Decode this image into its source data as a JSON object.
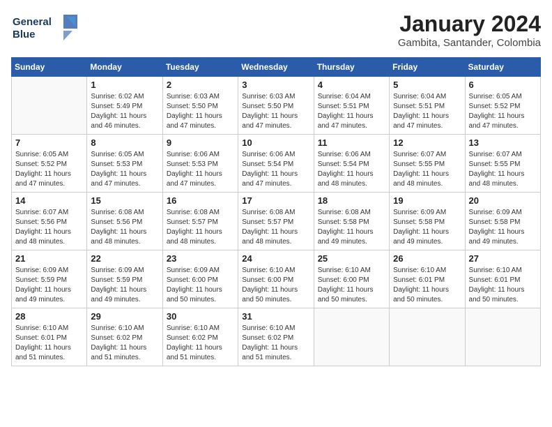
{
  "logo": {
    "line1": "General",
    "line2": "Blue"
  },
  "title": "January 2024",
  "subtitle": "Gambita, Santander, Colombia",
  "days_of_week": [
    "Sunday",
    "Monday",
    "Tuesday",
    "Wednesday",
    "Thursday",
    "Friday",
    "Saturday"
  ],
  "weeks": [
    [
      {
        "day": "",
        "info": ""
      },
      {
        "day": "1",
        "info": "Sunrise: 6:02 AM\nSunset: 5:49 PM\nDaylight: 11 hours\nand 46 minutes."
      },
      {
        "day": "2",
        "info": "Sunrise: 6:03 AM\nSunset: 5:50 PM\nDaylight: 11 hours\nand 47 minutes."
      },
      {
        "day": "3",
        "info": "Sunrise: 6:03 AM\nSunset: 5:50 PM\nDaylight: 11 hours\nand 47 minutes."
      },
      {
        "day": "4",
        "info": "Sunrise: 6:04 AM\nSunset: 5:51 PM\nDaylight: 11 hours\nand 47 minutes."
      },
      {
        "day": "5",
        "info": "Sunrise: 6:04 AM\nSunset: 5:51 PM\nDaylight: 11 hours\nand 47 minutes."
      },
      {
        "day": "6",
        "info": "Sunrise: 6:05 AM\nSunset: 5:52 PM\nDaylight: 11 hours\nand 47 minutes."
      }
    ],
    [
      {
        "day": "7",
        "info": "Sunrise: 6:05 AM\nSunset: 5:52 PM\nDaylight: 11 hours\nand 47 minutes."
      },
      {
        "day": "8",
        "info": "Sunrise: 6:05 AM\nSunset: 5:53 PM\nDaylight: 11 hours\nand 47 minutes."
      },
      {
        "day": "9",
        "info": "Sunrise: 6:06 AM\nSunset: 5:53 PM\nDaylight: 11 hours\nand 47 minutes."
      },
      {
        "day": "10",
        "info": "Sunrise: 6:06 AM\nSunset: 5:54 PM\nDaylight: 11 hours\nand 47 minutes."
      },
      {
        "day": "11",
        "info": "Sunrise: 6:06 AM\nSunset: 5:54 PM\nDaylight: 11 hours\nand 48 minutes."
      },
      {
        "day": "12",
        "info": "Sunrise: 6:07 AM\nSunset: 5:55 PM\nDaylight: 11 hours\nand 48 minutes."
      },
      {
        "day": "13",
        "info": "Sunrise: 6:07 AM\nSunset: 5:55 PM\nDaylight: 11 hours\nand 48 minutes."
      }
    ],
    [
      {
        "day": "14",
        "info": "Sunrise: 6:07 AM\nSunset: 5:56 PM\nDaylight: 11 hours\nand 48 minutes."
      },
      {
        "day": "15",
        "info": "Sunrise: 6:08 AM\nSunset: 5:56 PM\nDaylight: 11 hours\nand 48 minutes."
      },
      {
        "day": "16",
        "info": "Sunrise: 6:08 AM\nSunset: 5:57 PM\nDaylight: 11 hours\nand 48 minutes."
      },
      {
        "day": "17",
        "info": "Sunrise: 6:08 AM\nSunset: 5:57 PM\nDaylight: 11 hours\nand 48 minutes."
      },
      {
        "day": "18",
        "info": "Sunrise: 6:08 AM\nSunset: 5:58 PM\nDaylight: 11 hours\nand 49 minutes."
      },
      {
        "day": "19",
        "info": "Sunrise: 6:09 AM\nSunset: 5:58 PM\nDaylight: 11 hours\nand 49 minutes."
      },
      {
        "day": "20",
        "info": "Sunrise: 6:09 AM\nSunset: 5:58 PM\nDaylight: 11 hours\nand 49 minutes."
      }
    ],
    [
      {
        "day": "21",
        "info": "Sunrise: 6:09 AM\nSunset: 5:59 PM\nDaylight: 11 hours\nand 49 minutes."
      },
      {
        "day": "22",
        "info": "Sunrise: 6:09 AM\nSunset: 5:59 PM\nDaylight: 11 hours\nand 49 minutes."
      },
      {
        "day": "23",
        "info": "Sunrise: 6:09 AM\nSunset: 6:00 PM\nDaylight: 11 hours\nand 50 minutes."
      },
      {
        "day": "24",
        "info": "Sunrise: 6:10 AM\nSunset: 6:00 PM\nDaylight: 11 hours\nand 50 minutes."
      },
      {
        "day": "25",
        "info": "Sunrise: 6:10 AM\nSunset: 6:00 PM\nDaylight: 11 hours\nand 50 minutes."
      },
      {
        "day": "26",
        "info": "Sunrise: 6:10 AM\nSunset: 6:01 PM\nDaylight: 11 hours\nand 50 minutes."
      },
      {
        "day": "27",
        "info": "Sunrise: 6:10 AM\nSunset: 6:01 PM\nDaylight: 11 hours\nand 50 minutes."
      }
    ],
    [
      {
        "day": "28",
        "info": "Sunrise: 6:10 AM\nSunset: 6:01 PM\nDaylight: 11 hours\nand 51 minutes."
      },
      {
        "day": "29",
        "info": "Sunrise: 6:10 AM\nSunset: 6:02 PM\nDaylight: 11 hours\nand 51 minutes."
      },
      {
        "day": "30",
        "info": "Sunrise: 6:10 AM\nSunset: 6:02 PM\nDaylight: 11 hours\nand 51 minutes."
      },
      {
        "day": "31",
        "info": "Sunrise: 6:10 AM\nSunset: 6:02 PM\nDaylight: 11 hours\nand 51 minutes."
      },
      {
        "day": "",
        "info": ""
      },
      {
        "day": "",
        "info": ""
      },
      {
        "day": "",
        "info": ""
      }
    ]
  ]
}
